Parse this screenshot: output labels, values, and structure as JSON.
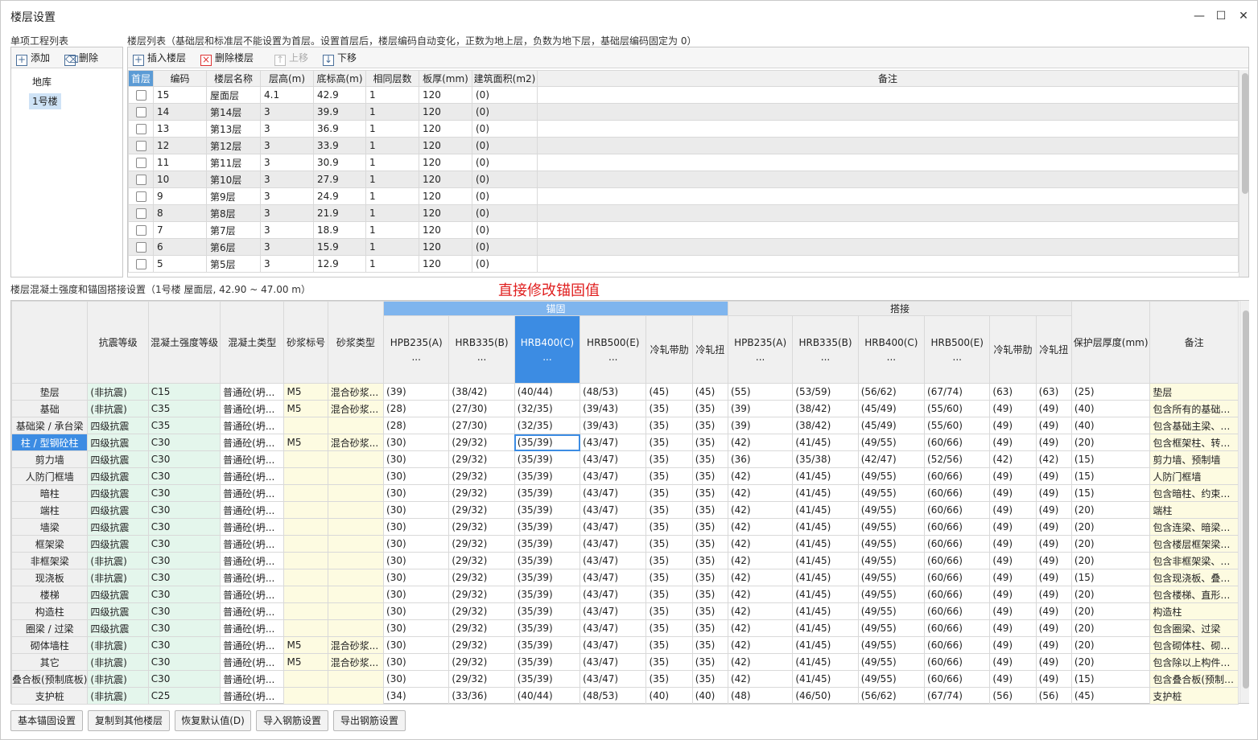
{
  "window": {
    "title": "楼层设置",
    "minimize": "—",
    "maximize": "☐",
    "close": "✕"
  },
  "project_list": {
    "label": "单项工程列表",
    "add_label": "添加",
    "delete_label": "删除",
    "items": [
      "地库",
      "1号楼"
    ],
    "selected": "1号楼"
  },
  "floor_list": {
    "label": "楼层列表（基础层和标准层不能设置为首层。设置首层后，楼层编码自动变化，正数为地上层，负数为地下层，基础层编码固定为 0）",
    "toolbar": {
      "insert": "插入楼层",
      "delete": "删除楼层",
      "up": "上移",
      "down": "下移"
    },
    "columns": [
      "首层",
      "编码",
      "楼层名称",
      "层高(m)",
      "底标高(m)",
      "相同层数",
      "板厚(mm)",
      "建筑面积(m2)",
      "备注"
    ],
    "rows": [
      [
        "15",
        "屋面层",
        "4.1",
        "42.9",
        "1",
        "120",
        "(0)",
        ""
      ],
      [
        "14",
        "第14层",
        "3",
        "39.9",
        "1",
        "120",
        "(0)",
        ""
      ],
      [
        "13",
        "第13层",
        "3",
        "36.9",
        "1",
        "120",
        "(0)",
        ""
      ],
      [
        "12",
        "第12层",
        "3",
        "33.9",
        "1",
        "120",
        "(0)",
        ""
      ],
      [
        "11",
        "第11层",
        "3",
        "30.9",
        "1",
        "120",
        "(0)",
        ""
      ],
      [
        "10",
        "第10层",
        "3",
        "27.9",
        "1",
        "120",
        "(0)",
        ""
      ],
      [
        "9",
        "第9层",
        "3",
        "24.9",
        "1",
        "120",
        "(0)",
        ""
      ],
      [
        "8",
        "第8层",
        "3",
        "21.9",
        "1",
        "120",
        "(0)",
        ""
      ],
      [
        "7",
        "第7层",
        "3",
        "18.9",
        "1",
        "120",
        "(0)",
        ""
      ],
      [
        "6",
        "第6层",
        "3",
        "15.9",
        "1",
        "120",
        "(0)",
        ""
      ],
      [
        "5",
        "第5层",
        "3",
        "12.9",
        "1",
        "120",
        "(0)",
        ""
      ]
    ]
  },
  "rebar_section": {
    "label": "楼层混凝土强度和锚固搭接设置（1号楼  屋面层, 42.90 ~ 47.00 m）",
    "hint": "直接修改锚固值",
    "group_anchor": "锚固",
    "group_lap": "搭接",
    "headers_left": [
      "抗震等级",
      "混凝土强度等级",
      "混凝土类型",
      "砂浆标号",
      "砂浆类型"
    ],
    "headers_anchor": [
      "HPB235(A)\n...",
      "HRB335(B)\n...",
      "HRB400(C)\n...",
      "HRB500(E)\n...",
      "冷轧带肋",
      "冷轧扭"
    ],
    "headers_lap": [
      "HPB235(A)\n...",
      "HRB335(B)\n...",
      "HRB400(C)\n...",
      "HRB500(E)\n...",
      "冷轧带肋",
      "冷轧扭"
    ],
    "headers_right": [
      "保护层厚度(mm)",
      "备注"
    ],
    "rows": [
      {
        "name": "垫层",
        "cells": [
          "(非抗震)",
          "C15",
          "普通砼(坍...",
          "M5",
          "混合砂浆...",
          "(39)",
          "(38/42)",
          "(40/44)",
          "(48/53)",
          "(45)",
          "(45)",
          "(55)",
          "(53/59)",
          "(56/62)",
          "(67/74)",
          "(63)",
          "(63)",
          "(25)",
          "垫层"
        ]
      },
      {
        "name": "基础",
        "cells": [
          "(非抗震)",
          "C35",
          "普通砼(坍...",
          "M5",
          "混合砂浆...",
          "(28)",
          "(27/30)",
          "(32/35)",
          "(39/43)",
          "(35)",
          "(35)",
          "(39)",
          "(38/42)",
          "(45/49)",
          "(55/60)",
          "(49)",
          "(49)",
          "(40)",
          "包含所有的基础构..."
        ]
      },
      {
        "name": "基础梁 / 承台梁",
        "cells": [
          "四级抗震",
          "C35",
          "普通砼(坍...",
          "",
          "",
          "(28)",
          "(27/30)",
          "(32/35)",
          "(39/43)",
          "(35)",
          "(35)",
          "(39)",
          "(38/42)",
          "(45/49)",
          "(55/60)",
          "(49)",
          "(49)",
          "(40)",
          "包含基础主梁、基..."
        ]
      },
      {
        "name": "柱 / 型钢砼柱",
        "cells": [
          "四级抗震",
          "C30",
          "普通砼(坍...",
          "M5",
          "混合砂浆...",
          "(30)",
          "(29/32)",
          "(35/39)",
          "(43/47)",
          "(35)",
          "(35)",
          "(42)",
          "(41/45)",
          "(49/55)",
          "(60/66)",
          "(49)",
          "(49)",
          "(20)",
          "包含框架柱、转换..."
        ]
      },
      {
        "name": "剪力墙",
        "cells": [
          "四级抗震",
          "C30",
          "普通砼(坍...",
          "",
          "",
          "(30)",
          "(29/32)",
          "(35/39)",
          "(43/47)",
          "(35)",
          "(35)",
          "(36)",
          "(35/38)",
          "(42/47)",
          "(52/56)",
          "(42)",
          "(42)",
          "(15)",
          "剪力墙、预制墙"
        ]
      },
      {
        "name": "人防门框墙",
        "cells": [
          "四级抗震",
          "C30",
          "普通砼(坍...",
          "",
          "",
          "(30)",
          "(29/32)",
          "(35/39)",
          "(43/47)",
          "(35)",
          "(35)",
          "(42)",
          "(41/45)",
          "(49/55)",
          "(60/66)",
          "(49)",
          "(49)",
          "(15)",
          "人防门框墙"
        ]
      },
      {
        "name": "暗柱",
        "cells": [
          "四级抗震",
          "C30",
          "普通砼(坍...",
          "",
          "",
          "(30)",
          "(29/32)",
          "(35/39)",
          "(43/47)",
          "(35)",
          "(35)",
          "(42)",
          "(41/45)",
          "(49/55)",
          "(60/66)",
          "(49)",
          "(49)",
          "(15)",
          "包含暗柱、约束边..."
        ]
      },
      {
        "name": "端柱",
        "cells": [
          "四级抗震",
          "C30",
          "普通砼(坍...",
          "",
          "",
          "(30)",
          "(29/32)",
          "(35/39)",
          "(43/47)",
          "(35)",
          "(35)",
          "(42)",
          "(41/45)",
          "(49/55)",
          "(60/66)",
          "(49)",
          "(49)",
          "(20)",
          "端柱"
        ]
      },
      {
        "name": "墙梁",
        "cells": [
          "四级抗震",
          "C30",
          "普通砼(坍...",
          "",
          "",
          "(30)",
          "(29/32)",
          "(35/39)",
          "(43/47)",
          "(35)",
          "(35)",
          "(42)",
          "(41/45)",
          "(49/55)",
          "(60/66)",
          "(49)",
          "(49)",
          "(20)",
          "包含连梁、暗梁、..."
        ]
      },
      {
        "name": "框架梁",
        "cells": [
          "四级抗震",
          "C30",
          "普通砼(坍...",
          "",
          "",
          "(30)",
          "(29/32)",
          "(35/39)",
          "(43/47)",
          "(35)",
          "(35)",
          "(42)",
          "(41/45)",
          "(49/55)",
          "(60/66)",
          "(49)",
          "(49)",
          "(20)",
          "包含楼层框架梁、..."
        ]
      },
      {
        "name": "非框架梁",
        "cells": [
          "(非抗震)",
          "C30",
          "普通砼(坍...",
          "",
          "",
          "(30)",
          "(29/32)",
          "(35/39)",
          "(43/47)",
          "(35)",
          "(35)",
          "(42)",
          "(41/45)",
          "(49/55)",
          "(60/66)",
          "(49)",
          "(49)",
          "(20)",
          "包含非框架梁、井..."
        ]
      },
      {
        "name": "现浇板",
        "cells": [
          "(非抗震)",
          "C30",
          "普通砼(坍...",
          "",
          "",
          "(30)",
          "(29/32)",
          "(35/39)",
          "(43/47)",
          "(35)",
          "(35)",
          "(42)",
          "(41/45)",
          "(49/55)",
          "(60/66)",
          "(49)",
          "(49)",
          "(15)",
          "包含现浇板、叠合..."
        ]
      },
      {
        "name": "楼梯",
        "cells": [
          "四级抗震",
          "C30",
          "普通砼(坍...",
          "",
          "",
          "(30)",
          "(29/32)",
          "(35/39)",
          "(43/47)",
          "(35)",
          "(35)",
          "(42)",
          "(41/45)",
          "(49/55)",
          "(60/66)",
          "(49)",
          "(49)",
          "(20)",
          "包含楼梯、直形梯..."
        ]
      },
      {
        "name": "构造柱",
        "cells": [
          "四级抗震",
          "C30",
          "普通砼(坍...",
          "",
          "",
          "(30)",
          "(29/32)",
          "(35/39)",
          "(43/47)",
          "(35)",
          "(35)",
          "(42)",
          "(41/45)",
          "(49/55)",
          "(60/66)",
          "(49)",
          "(49)",
          "(20)",
          "构造柱"
        ]
      },
      {
        "name": "圈梁 / 过梁",
        "cells": [
          "四级抗震",
          "C30",
          "普通砼(坍...",
          "",
          "",
          "(30)",
          "(29/32)",
          "(35/39)",
          "(43/47)",
          "(35)",
          "(35)",
          "(42)",
          "(41/45)",
          "(49/55)",
          "(60/66)",
          "(49)",
          "(49)",
          "(20)",
          "包含圈梁、过梁"
        ]
      },
      {
        "name": "砌体墙柱",
        "cells": [
          "(非抗震)",
          "C30",
          "普通砼(坍...",
          "M5",
          "混合砂浆...",
          "(30)",
          "(29/32)",
          "(35/39)",
          "(43/47)",
          "(35)",
          "(35)",
          "(42)",
          "(41/45)",
          "(49/55)",
          "(60/66)",
          "(49)",
          "(49)",
          "(20)",
          "包含砌体柱、砌体墙"
        ]
      },
      {
        "name": "其它",
        "cells": [
          "(非抗震)",
          "C30",
          "普通砼(坍...",
          "M5",
          "混合砂浆...",
          "(30)",
          "(29/32)",
          "(35/39)",
          "(43/47)",
          "(35)",
          "(35)",
          "(42)",
          "(41/45)",
          "(49/55)",
          "(60/66)",
          "(49)",
          "(49)",
          "(20)",
          "包含除以上构件类..."
        ]
      },
      {
        "name": "叠合板(预制底板)",
        "cells": [
          "(非抗震)",
          "C30",
          "普通砼(坍...",
          "",
          "",
          "(30)",
          "(29/32)",
          "(35/39)",
          "(43/47)",
          "(35)",
          "(35)",
          "(42)",
          "(41/45)",
          "(49/55)",
          "(60/66)",
          "(49)",
          "(49)",
          "(15)",
          "包含叠合板(预制底..."
        ]
      },
      {
        "name": "支护桩",
        "cells": [
          "(非抗震)",
          "C25",
          "普通砼(坍...",
          "",
          "",
          "(34)",
          "(33/36)",
          "(40/44)",
          "(48/53)",
          "(40)",
          "(40)",
          "(48)",
          "(46/50)",
          "(56/62)",
          "(67/74)",
          "(56)",
          "(56)",
          "(45)",
          "支护桩"
        ]
      }
    ]
  },
  "bottom_buttons": [
    "基本锚固设置",
    "复制到其他楼层",
    "恢复默认值(D)",
    "导入钢筋设置",
    "导出钢筋设置"
  ]
}
